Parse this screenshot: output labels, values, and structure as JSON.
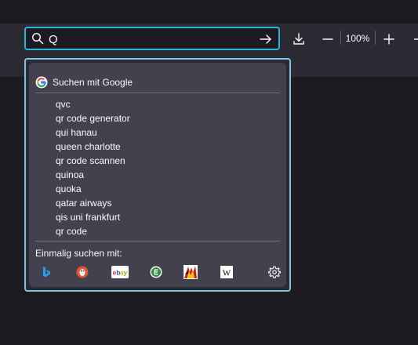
{
  "urlbar": {
    "value": "Q"
  },
  "toolbar": {
    "zoom": "100%",
    "icons": [
      "search-icon",
      "arrow-right-icon",
      "download-icon",
      "zoom-out-icon",
      "zoom-in-icon"
    ]
  },
  "popup": {
    "header": "Suchen mit Google",
    "suggestions": [
      "qvc",
      "qr code generator",
      "qui hanau",
      "queen charlotte",
      "qr code scannen",
      "quinoa",
      "quoka",
      "qatar airways",
      "qis uni frankfurt",
      "qr code"
    ],
    "oneoff_label": "Einmalig suchen mit:",
    "engines": [
      "bing-icon",
      "duckduckgo-icon",
      "ebay-icon",
      "ecosia-icon",
      "leo-icon",
      "wikipedia-icon",
      "gear-icon"
    ]
  },
  "colors": {
    "accent": "#28b7d7",
    "popup_bg": "#42414d",
    "toolbar_bg": "#2b2a33",
    "page_bg": "#1c1b22"
  }
}
